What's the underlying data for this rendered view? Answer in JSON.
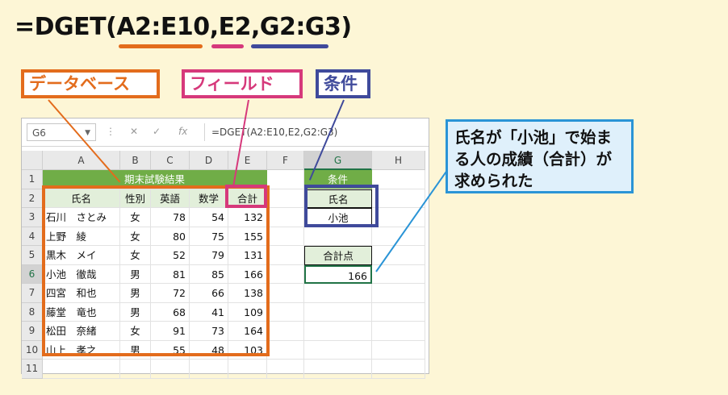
{
  "formula": {
    "prefix": "=DGET(",
    "arg1": "A2:E10",
    "sep1": ",",
    "arg2": "E2",
    "sep2": ",",
    "arg3": "G2:G3",
    "suffix": ")"
  },
  "labels": {
    "database": "データベース",
    "field": "フィールド",
    "criteria": "条件"
  },
  "colors": {
    "database": "#e36c1c",
    "field": "#d6397b",
    "criteria": "#3f4a9b",
    "callout": "#2a94d6",
    "title_fill": "#70ad47",
    "header_fill": "#e2efda"
  },
  "excel": {
    "name_box": "G6",
    "formula_text": "=DGET(A2:E10,E2,G2:G3)",
    "columns": [
      "A",
      "B",
      "C",
      "D",
      "E",
      "F",
      "G",
      "H"
    ],
    "rows": [
      "1",
      "2",
      "3",
      "4",
      "5",
      "6",
      "7",
      "8",
      "9",
      "10",
      "11"
    ],
    "table_title": "期末試験結果",
    "headers": [
      "氏名",
      "性別",
      "英語",
      "数学",
      "合計"
    ],
    "records": [
      [
        "石川　さとみ",
        "女",
        "78",
        "54",
        "132"
      ],
      [
        "上野　綾",
        "女",
        "80",
        "75",
        "155"
      ],
      [
        "黒木　メイ",
        "女",
        "52",
        "79",
        "131"
      ],
      [
        "小池　徹哉",
        "男",
        "81",
        "85",
        "166"
      ],
      [
        "四宮　和也",
        "男",
        "72",
        "66",
        "138"
      ],
      [
        "藤堂　竜也",
        "男",
        "68",
        "41",
        "109"
      ],
      [
        "松田　奈緒",
        "女",
        "91",
        "73",
        "164"
      ],
      [
        "山上　孝之",
        "男",
        "55",
        "48",
        "103"
      ]
    ],
    "criteria_title": "条件",
    "criteria_header": "氏名",
    "criteria_value": "小池",
    "result_label": "合計点",
    "result_value": "166"
  },
  "callout": {
    "line1": "氏名が「小池」で始ま",
    "line2": "る人の成績（合計）が",
    "line3": "求められた"
  }
}
